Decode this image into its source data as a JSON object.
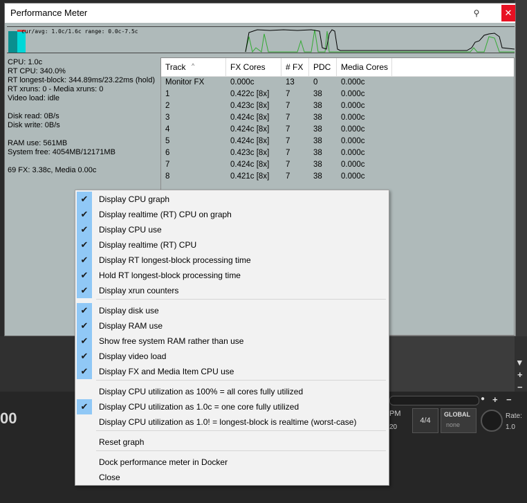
{
  "window": {
    "title": "Performance Meter",
    "close_glyph": "✕",
    "pin_glyph": "⚲"
  },
  "graph": {
    "legend": "cur/avg: 1.0c/1.6c  range: 0.0c-7.5c",
    "colors": {
      "cpu": "#000000",
      "rt": "#33aa33",
      "bar": "#00d8d8",
      "peak": "#d84040"
    }
  },
  "stats": {
    "cpu": "CPU: 1.0c",
    "rt_cpu": "RT CPU: 340.0%",
    "rt_longest": "RT longest-block: 344.89ms/23.22ms (hold)",
    "rt_xruns": "RT xruns: 0 - Media xruns: 0",
    "video_load": "Video load: idle",
    "disk_read": "Disk read: 0B/s",
    "disk_write": "Disk write: 0B/s",
    "ram_use": "RAM use: 561MB",
    "system_free": "System free: 4054MB/12171MB",
    "fx_summary": "69 FX: 3.38c, Media 0.00c"
  },
  "table": {
    "headers": [
      "Track",
      "FX Cores",
      "# FX",
      "PDC",
      "Media Cores"
    ],
    "rows": [
      [
        "Monitor FX",
        "0.000c",
        "13",
        "0",
        "0.000c"
      ],
      [
        "1",
        "0.422c [8x]",
        "7",
        "38",
        "0.000c"
      ],
      [
        "2",
        "0.423c [8x]",
        "7",
        "38",
        "0.000c"
      ],
      [
        "3",
        "0.424c [8x]",
        "7",
        "38",
        "0.000c"
      ],
      [
        "4",
        "0.424c [8x]",
        "7",
        "38",
        "0.000c"
      ],
      [
        "5",
        "0.424c [8x]",
        "7",
        "38",
        "0.000c"
      ],
      [
        "6",
        "0.423c [8x]",
        "7",
        "38",
        "0.000c"
      ],
      [
        "7",
        "0.424c [8x]",
        "7",
        "38",
        "0.000c"
      ],
      [
        "8",
        "0.421c [8x]",
        "7",
        "38",
        "0.000c"
      ]
    ]
  },
  "menu": {
    "check_glyph": "✔",
    "items": [
      {
        "label": "Display CPU graph",
        "checked": true
      },
      {
        "label": "Display realtime (RT) CPU on graph",
        "checked": true
      },
      {
        "label": "Display CPU use",
        "checked": true
      },
      {
        "label": "Display realtime (RT) CPU",
        "checked": true
      },
      {
        "label": "Display RT longest-block processing time",
        "checked": true
      },
      {
        "label": "Hold RT longest-block processing time",
        "checked": true
      },
      {
        "label": "Display xrun counters",
        "checked": true
      },
      {
        "label": "Display disk use",
        "checked": true
      },
      {
        "label": "Display RAM use",
        "checked": true
      },
      {
        "label": "Show free system RAM rather than use",
        "checked": true
      },
      {
        "label": "Display video load",
        "checked": true
      },
      {
        "label": "Display FX and Media Item CPU use",
        "checked": true
      },
      {
        "label": "Display CPU utilization as 100% = all cores fully utilized",
        "checked": false
      },
      {
        "label": "Display CPU utilization as 1.0c = one core fully utilized",
        "checked": true
      },
      {
        "label": "Display CPU utilization as 1.0! = longest-block is realtime (worst-case)",
        "checked": false
      },
      {
        "label": "Reset graph",
        "checked": false
      },
      {
        "label": "Dock performance meter in Docker",
        "checked": false
      },
      {
        "label": "Close",
        "checked": false
      }
    ]
  },
  "background": {
    "timer_fragment": "00",
    "pm_fragment": "PM",
    "pm_value": "20",
    "time_signature": "4/4",
    "global_label": "GLOBAL",
    "global_value": "none",
    "rate_label": "Rate:",
    "rate_value": "1.0"
  }
}
